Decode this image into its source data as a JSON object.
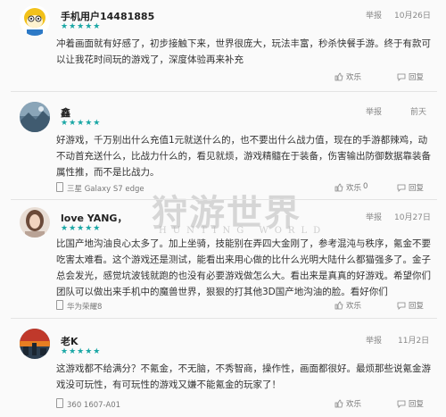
{
  "watermark": {
    "title": "狩游世界",
    "subtitle": "HUNTING WORLD"
  },
  "reviews": [
    {
      "username": "手机用户14481885",
      "stars": "★★★★★",
      "report": "举报",
      "date": "10月26日",
      "text": "冲着画面就有好感了，初步接触下来，世界很庞大，玩法丰富，秒杀快餐手游。终于有款可以让我花时间玩的游戏了，深度体验再来补充",
      "device": "",
      "actions": [
        "欢乐",
        "回复"
      ]
    },
    {
      "username": "鑫",
      "stars": "★★★★★",
      "report": "举报",
      "date": "前天",
      "text": "好游戏，千万别出什么充值1元就送什么的，也不要出什么战力值，现在的手游都辣鸡，动不动首充送什么，比战力什么的，看见就烦，游戏精髓在于装备，伤害输出防御数据靠装备属性推，而不是比战力。",
      "device": "三星 Galaxy S7 edge",
      "actions": [
        "欢乐",
        "0",
        "回复"
      ]
    },
    {
      "username": "love YANG，",
      "stars": "★★★★★",
      "report": "举报",
      "date": "10月27日",
      "text": "比国产地沟油良心太多了。加上坐骑，技能别在弄四大金刚了，参考混沌与秩序，氪金不要吃害太难看。这个游戏还是测试，能看出来用心做的比什么光明大陆什么都猫强多了。金子总会发光，感觉坑波钱就跑的也没有必要游戏做怎么大。看出来是真真的好游戏。希望你们团队可以做出来手机中的魔兽世界，狠狠的打其他3D国产地沟油的脸。看好你们",
      "device": "华为荣耀8",
      "actions": [
        "欢乐",
        "回复"
      ]
    },
    {
      "username": "老K",
      "stars": "★★★★★",
      "report": "举报",
      "date": "11月2日",
      "text": "这游戏都不给满分？不氪金，不无脑，不秀智商，操作性，画面都很好。最烦那些说氪金游戏没可玩性，有可玩性的游戏又嫌不能氪金的玩家了！",
      "device": "360 1607-A01",
      "actions": [
        "欢乐",
        "回复"
      ]
    }
  ],
  "colors": {
    "stars": "#1aa7a5",
    "avatar_mouse": "#f2c11a",
    "avatar_landscape": "#405b70",
    "avatar_person": "#6b4a39",
    "avatar_sunset": "#c0392b"
  }
}
